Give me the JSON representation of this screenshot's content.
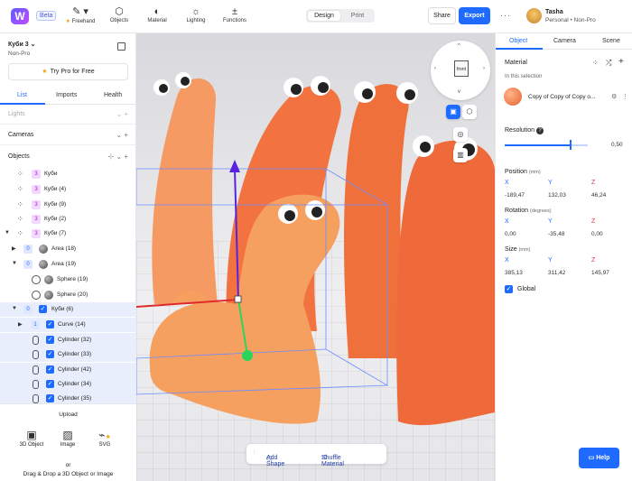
{
  "app": {
    "logo_letter": "W",
    "badge": "Beta"
  },
  "toolbar": {
    "tools": [
      {
        "label": "Freehand",
        "icon": "pen-icon"
      },
      {
        "label": "Objects",
        "icon": "objects-icon"
      },
      {
        "label": "Material",
        "icon": "material-icon"
      },
      {
        "label": "Lighting",
        "icon": "lighting-icon"
      },
      {
        "label": "Functions",
        "icon": "functions-icon"
      }
    ],
    "mode_design": "Design",
    "mode_print": "Print",
    "share": "Share",
    "export": "Export",
    "more": "···"
  },
  "user": {
    "name": "Tasha",
    "plan": "Personal • Non-Pro"
  },
  "left": {
    "project_name": "Куби 3",
    "project_plan": "Non-Pro",
    "try_pro": "Try Pro for Free",
    "tabs": [
      "List",
      "Imports",
      "Health"
    ],
    "sections": {
      "lights": "Lights",
      "cameras": "Cameras",
      "objects": "Objects"
    },
    "rows": [
      {
        "label": "Куби",
        "count": "3"
      },
      {
        "label": "Куби (4)",
        "count": "3"
      },
      {
        "label": "Куби (9)",
        "count": "3"
      },
      {
        "label": "Куби (2)",
        "count": "3"
      },
      {
        "label": "Куби (7)",
        "count": "3"
      },
      {
        "label": "Area (18)",
        "count": "0"
      },
      {
        "label": "Area (19)",
        "count": "0"
      },
      {
        "label": "Sphere (19)"
      },
      {
        "label": "Sphere (20)"
      },
      {
        "label": "Куби (6)",
        "count": "0"
      },
      {
        "label": "Curve (14)",
        "count": "1"
      },
      {
        "label": "Cylinder (32)"
      },
      {
        "label": "Cylinder (33)"
      },
      {
        "label": "Cylinder (42)"
      },
      {
        "label": "Cylinder (34)"
      },
      {
        "label": "Cylinder (35)"
      }
    ],
    "upload": {
      "title": "Upload",
      "options": [
        "3D Object",
        "Image",
        "SVG"
      ],
      "or": "or",
      "drop": "Drag & Drop a 3D Object or Image"
    }
  },
  "viewport": {
    "nav_label": "front",
    "add_shape": "Add Shape",
    "shuffle_material": "Shuffle Material"
  },
  "right": {
    "tabs": [
      "Object",
      "Camera",
      "Scene"
    ],
    "material_title": "Material",
    "in_selection": "In this selection",
    "material_name": "Copy of Copy of Copy o...",
    "resolution_label": "Resolution",
    "resolution_value": "0,50",
    "resolution_fraction": 0.78,
    "position": {
      "label": "Position",
      "unit": "(mm)",
      "x": "-189,47",
      "y": "132,03",
      "z": "46,24"
    },
    "rotation": {
      "label": "Rotation",
      "unit": "(degrees)",
      "x": "0,00",
      "y": "-35,48",
      "z": "0,00"
    },
    "size": {
      "label": "Size",
      "unit": "(mm)",
      "x": "385,13",
      "y": "311,42",
      "z": "145,97"
    },
    "axes": [
      "X",
      "Y",
      "Z"
    ],
    "global": "Global"
  },
  "help": "Help",
  "colors": {
    "accent": "#1f6bff",
    "creature": "#f47a48",
    "pro_star": "#f0a31a"
  }
}
